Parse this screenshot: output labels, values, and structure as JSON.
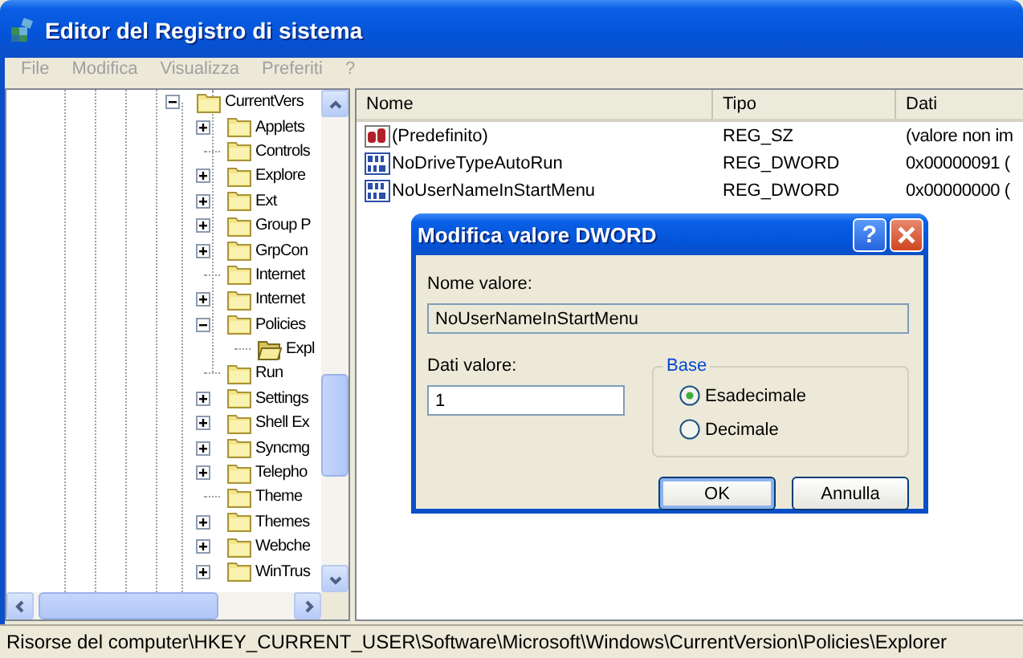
{
  "window": {
    "title": "Editor del Registro di sistema"
  },
  "menu": [
    {
      "label": "File",
      "disabled": true
    },
    {
      "label": "Modifica",
      "disabled": true
    },
    {
      "label": "Visualizza",
      "disabled": true
    },
    {
      "label": "Preferiti",
      "disabled": true
    },
    {
      "label": "?",
      "disabled": true
    }
  ],
  "tree": [
    {
      "label": "CurrentVers",
      "expanded": true,
      "selected": false,
      "children": [
        {
          "label": "Applets",
          "expanded": false,
          "selected": false
        },
        {
          "label": "Controls",
          "selected": false
        },
        {
          "label": "Explore",
          "expanded": false,
          "selected": false
        },
        {
          "label": "Ext",
          "expanded": false,
          "selected": false
        },
        {
          "label": "Group P",
          "expanded": false,
          "selected": false
        },
        {
          "label": "GrpCon",
          "expanded": false,
          "selected": false
        },
        {
          "label": "Internet",
          "selected": false
        },
        {
          "label": "Internet",
          "expanded": false,
          "selected": false
        },
        {
          "label": "Policies",
          "expanded": true,
          "selected": false,
          "children": [
            {
              "label": "Expl",
              "selected": true
            }
          ]
        },
        {
          "label": "Run",
          "selected": false
        },
        {
          "label": "Settings",
          "expanded": false,
          "selected": false
        },
        {
          "label": "Shell Ex",
          "expanded": false,
          "selected": false
        },
        {
          "label": "Syncmg",
          "expanded": false,
          "selected": false
        },
        {
          "label": "Telepho",
          "expanded": false,
          "selected": false
        },
        {
          "label": "Theme",
          "selected": false
        },
        {
          "label": "Themes",
          "expanded": false,
          "selected": false
        },
        {
          "label": "Webche",
          "expanded": false,
          "selected": false
        },
        {
          "label": "WinTrus",
          "expanded": false,
          "selected": false
        }
      ]
    }
  ],
  "list": {
    "columns": [
      "Nome",
      "Tipo",
      "Dati"
    ],
    "rows": [
      {
        "kind": "string",
        "name": "(Predefinito)",
        "type": "REG_SZ",
        "data": "(valore non im"
      },
      {
        "kind": "dword",
        "name": "NoDriveTypeAutoRun",
        "type": "REG_DWORD",
        "data": "0x00000091 ("
      },
      {
        "kind": "dword",
        "name": "NoUserNameInStartMenu",
        "type": "REG_DWORD",
        "data": "0x00000000 ("
      }
    ]
  },
  "dialog": {
    "title": "Modifica valore DWORD",
    "help": "?",
    "name_label": "Nome valore:",
    "name_value": "NoUserNameInStartMenu",
    "data_label": "Dati valore:",
    "data_value": "1",
    "base_label": "Base",
    "radios": [
      {
        "label": "Esadecimale",
        "selected": true
      },
      {
        "label": "Decimale",
        "selected": false
      }
    ],
    "buttons": [
      {
        "label": "OK",
        "default": true
      },
      {
        "label": "Annulla",
        "default": false
      }
    ]
  },
  "status_bar": "Risorse del computer\\HKEY_CURRENT_USER\\Software\\Microsoft\\Windows\\CurrentVersion\\Policies\\Explorer"
}
